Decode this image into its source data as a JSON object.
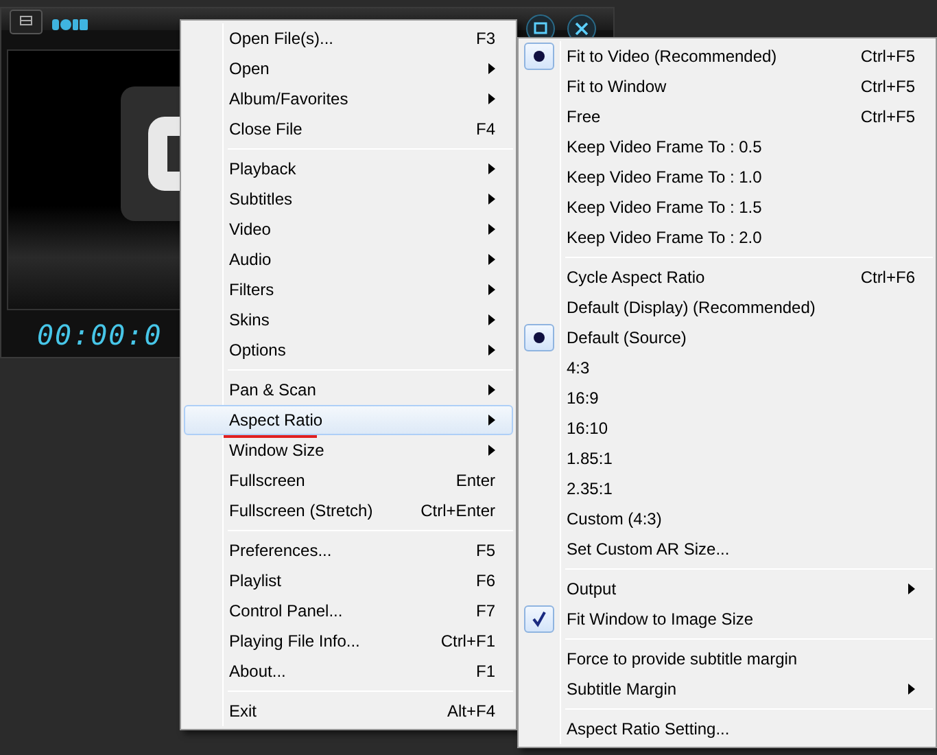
{
  "player": {
    "time": "00:00:0"
  },
  "context_menu": {
    "groups": [
      {
        "items": [
          {
            "label": "Open File(s)...",
            "shortcut": "F3",
            "submenu": false,
            "selected": false
          },
          {
            "label": "Open",
            "submenu": true,
            "selected": false
          },
          {
            "label": "Album/Favorites",
            "submenu": true,
            "selected": false
          },
          {
            "label": "Close File",
            "shortcut": "F4",
            "submenu": false,
            "selected": false
          }
        ]
      },
      {
        "items": [
          {
            "label": "Playback",
            "submenu": true,
            "selected": false
          },
          {
            "label": "Subtitles",
            "submenu": true,
            "selected": false
          },
          {
            "label": "Video",
            "submenu": true,
            "selected": false
          },
          {
            "label": "Audio",
            "submenu": true,
            "selected": false
          },
          {
            "label": "Filters",
            "submenu": true,
            "selected": false
          },
          {
            "label": "Skins",
            "submenu": true,
            "selected": false
          },
          {
            "label": "Options",
            "submenu": true,
            "selected": false
          }
        ]
      },
      {
        "items": [
          {
            "label": "Pan & Scan",
            "submenu": true,
            "selected": false
          },
          {
            "label": "Aspect Ratio",
            "submenu": true,
            "selected": true,
            "underlined": true
          },
          {
            "label": "Window Size",
            "submenu": true,
            "selected": false
          },
          {
            "label": "Fullscreen",
            "shortcut": "Enter",
            "submenu": false,
            "selected": false
          },
          {
            "label": "Fullscreen (Stretch)",
            "shortcut": "Ctrl+Enter",
            "submenu": false,
            "selected": false
          }
        ]
      },
      {
        "items": [
          {
            "label": "Preferences...",
            "shortcut": "F5",
            "submenu": false,
            "selected": false
          },
          {
            "label": "Playlist",
            "shortcut": "F6",
            "submenu": false,
            "selected": false
          },
          {
            "label": "Control Panel...",
            "shortcut": "F7",
            "submenu": false,
            "selected": false
          },
          {
            "label": "Playing File Info...",
            "shortcut": "Ctrl+F1",
            "submenu": false,
            "selected": false
          },
          {
            "label": "About...",
            "shortcut": "F1",
            "submenu": false,
            "selected": false
          }
        ]
      },
      {
        "items": [
          {
            "label": "Exit",
            "shortcut": "Alt+F4",
            "submenu": false,
            "selected": false
          }
        ]
      }
    ]
  },
  "aspect_ratio_submenu": {
    "groups": [
      {
        "items": [
          {
            "label": "Fit to Video (Recommended)",
            "shortcut": "Ctrl+F5",
            "submenu": false,
            "checked": true,
            "kind": "radio"
          },
          {
            "label": "Fit to Window",
            "shortcut": "Ctrl+F5",
            "submenu": false,
            "checked": false,
            "kind": "radio"
          },
          {
            "label": "Free",
            "shortcut": "Ctrl+F5",
            "submenu": false,
            "checked": false,
            "kind": "radio"
          },
          {
            "label": "Keep Video Frame To : 0.5",
            "submenu": false,
            "checked": false,
            "kind": "radio"
          },
          {
            "label": "Keep Video Frame To : 1.0",
            "submenu": false,
            "checked": false,
            "kind": "radio"
          },
          {
            "label": "Keep Video Frame To : 1.5",
            "submenu": false,
            "checked": false,
            "kind": "radio"
          },
          {
            "label": "Keep Video Frame To : 2.0",
            "submenu": false,
            "checked": false,
            "kind": "radio"
          }
        ]
      },
      {
        "items": [
          {
            "label": "Cycle Aspect Ratio",
            "shortcut": "Ctrl+F6",
            "submenu": false,
            "checked": false,
            "kind": "radio"
          },
          {
            "label": "Default (Display) (Recommended)",
            "submenu": false,
            "checked": false,
            "kind": "radio"
          },
          {
            "label": "Default (Source)",
            "submenu": false,
            "checked": true,
            "kind": "radio"
          },
          {
            "label": "4:3",
            "submenu": false,
            "checked": false,
            "kind": "radio"
          },
          {
            "label": "16:9",
            "submenu": false,
            "checked": false,
            "kind": "radio"
          },
          {
            "label": "16:10",
            "submenu": false,
            "checked": false,
            "kind": "radio"
          },
          {
            "label": "1.85:1",
            "submenu": false,
            "checked": false,
            "kind": "radio"
          },
          {
            "label": "2.35:1",
            "submenu": false,
            "checked": false,
            "kind": "radio"
          },
          {
            "label": "Custom (4:3)",
            "submenu": false,
            "checked": false,
            "kind": "radio"
          },
          {
            "label": "Set Custom AR Size...",
            "submenu": false,
            "checked": false,
            "kind": "radio"
          }
        ]
      },
      {
        "items": [
          {
            "label": "Output",
            "submenu": true,
            "checked": false,
            "kind": "check"
          },
          {
            "label": "Fit Window to Image Size",
            "submenu": false,
            "checked": true,
            "kind": "check"
          }
        ]
      },
      {
        "items": [
          {
            "label": "Force to provide subtitle margin",
            "submenu": false,
            "checked": false,
            "kind": "check"
          },
          {
            "label": "Subtitle Margin",
            "submenu": true,
            "checked": false,
            "kind": "check"
          }
        ]
      },
      {
        "items": [
          {
            "label": "Aspect Ratio Setting...",
            "submenu": false,
            "checked": false,
            "kind": "check"
          }
        ]
      }
    ]
  }
}
